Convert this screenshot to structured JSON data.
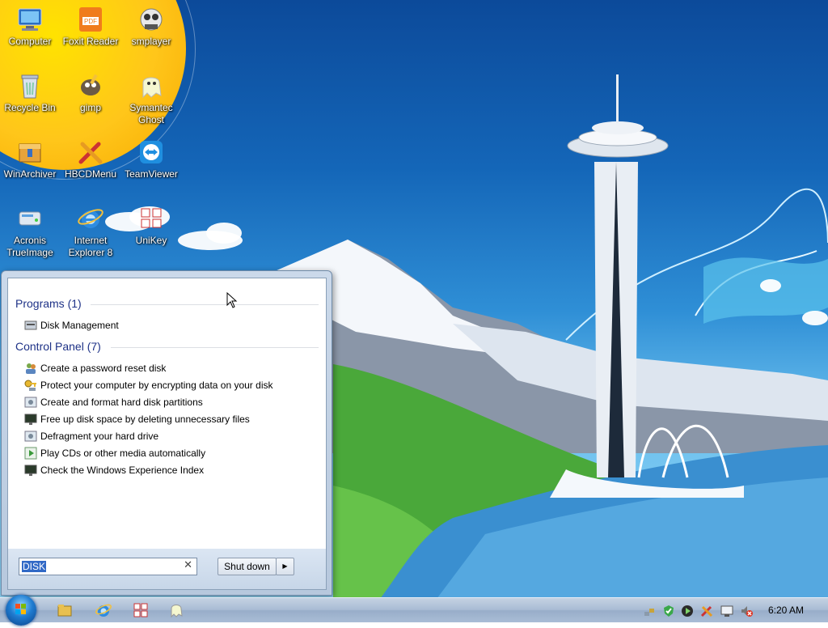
{
  "desktop": {
    "icons": [
      {
        "label": "Computer",
        "icon": "computer-icon"
      },
      {
        "label": "Foxit Reader",
        "icon": "pdf-reader-icon"
      },
      {
        "label": "smplayer",
        "icon": "media-player-icon"
      },
      {
        "label": "Recycle Bin",
        "icon": "recycle-bin-icon"
      },
      {
        "label": "gimp",
        "icon": "gimp-icon"
      },
      {
        "label": "Symantec Ghost",
        "icon": "ghost-icon"
      },
      {
        "label": "WinArchiver",
        "icon": "archive-icon"
      },
      {
        "label": "HBCDMenu",
        "icon": "tools-icon"
      },
      {
        "label": "TeamViewer",
        "icon": "remote-control-icon"
      },
      {
        "label": "Acronis TrueImage",
        "icon": "backup-icon"
      },
      {
        "label": "Internet Explorer 8",
        "icon": "internet-explorer-icon"
      },
      {
        "label": "UniKey",
        "icon": "keyboard-icon"
      }
    ]
  },
  "start_menu": {
    "groups": [
      {
        "title": "Programs (1)",
        "items": [
          {
            "label": "Disk Management",
            "icon": "disk-management-icon"
          }
        ]
      },
      {
        "title": "Control Panel (7)",
        "items": [
          {
            "label": "Create a password reset disk",
            "icon": "users-icon"
          },
          {
            "label": "Protect your computer by encrypting data on your disk",
            "icon": "key-icon"
          },
          {
            "label": "Create and format hard disk partitions",
            "icon": "admin-tools-icon"
          },
          {
            "label": "Free up disk space by deleting unnecessary files",
            "icon": "monitor-icon"
          },
          {
            "label": "Defragment your hard drive",
            "icon": "admin-tools-icon"
          },
          {
            "label": "Play CDs or other media automatically",
            "icon": "autoplay-icon"
          },
          {
            "label": "Check the Windows Experience Index",
            "icon": "monitor-icon"
          }
        ]
      }
    ],
    "search": {
      "value": "DISK"
    },
    "shutdown_label": "Shut down"
  },
  "taskbar": {
    "pinned": [
      "explorer-icon",
      "internet-explorer-icon",
      "unikey-icon",
      "ghost-icon"
    ],
    "tray": [
      "network-icon",
      "security-icon",
      "media-play-icon",
      "tools-icon",
      "display-icon",
      "volume-muted-icon"
    ],
    "clock": "6:20 AM"
  }
}
